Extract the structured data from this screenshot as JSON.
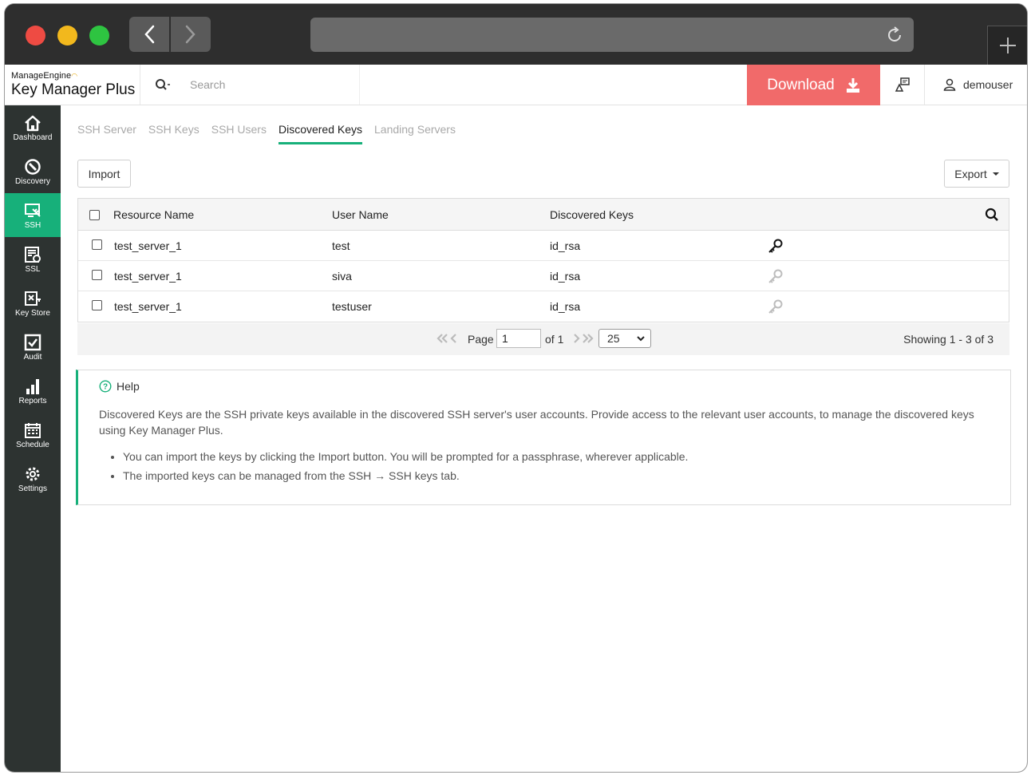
{
  "browser": {
    "window_controls": [
      "close",
      "minimize",
      "maximize"
    ],
    "nav_icons": [
      "chevron-left-icon",
      "chevron-right-icon"
    ],
    "reload_icon": "reload-icon",
    "new_tab_icon": "plus-icon"
  },
  "header": {
    "brand_small": "ManageEngine",
    "brand_product": "Key Manager Plus",
    "search_placeholder": "Search",
    "download_label": "Download",
    "username": "demouser"
  },
  "sidebar": {
    "items": [
      {
        "label": "Dashboard",
        "icon": "home-icon"
      },
      {
        "label": "Discovery",
        "icon": "compass-icon"
      },
      {
        "label": "SSH",
        "icon": "ssh-icon",
        "active": true
      },
      {
        "label": "SSL",
        "icon": "certificate-icon"
      },
      {
        "label": "Key Store",
        "icon": "key-store-icon"
      },
      {
        "label": "Audit",
        "icon": "audit-check-icon"
      },
      {
        "label": "Reports",
        "icon": "bar-chart-icon"
      },
      {
        "label": "Schedule",
        "icon": "calendar-icon"
      },
      {
        "label": "Settings",
        "icon": "gear-icon"
      }
    ]
  },
  "tabs": [
    {
      "label": "SSH Server"
    },
    {
      "label": "SSH Keys"
    },
    {
      "label": "SSH Users"
    },
    {
      "label": "Discovered Keys",
      "active": true
    },
    {
      "label": "Landing Servers"
    }
  ],
  "toolbar": {
    "import_label": "Import",
    "export_label": "Export"
  },
  "table": {
    "columns": [
      "Resource Name",
      "User Name",
      "Discovered Keys"
    ],
    "rows": [
      {
        "resource": "test_server_1",
        "user": "test",
        "key": "id_rsa",
        "key_icon_active": true
      },
      {
        "resource": "test_server_1",
        "user": "siva",
        "key": "id_rsa",
        "key_icon_active": false
      },
      {
        "resource": "test_server_1",
        "user": "testuser",
        "key": "id_rsa",
        "key_icon_active": false
      }
    ]
  },
  "pager": {
    "page_label": "Page",
    "page_value": "1",
    "of_label": "of 1",
    "page_size": "25",
    "showing": "Showing 1 - 3 of 3"
  },
  "help": {
    "title": "Help",
    "body": "Discovered Keys are the SSH private keys available in the discovered SSH server's user accounts. Provide access to the relevant user accounts, to manage the discovered keys using Key Manager Plus.",
    "bullets": [
      "You can import the keys by clicking the Import button. You will be prompted for a passphrase, wherever applicable.",
      "The imported keys can be managed from the SSH → SSH keys tab."
    ]
  },
  "colors": {
    "accent": "#17b07a",
    "download": "#f16a6a",
    "sidebar": "#2d3331"
  }
}
